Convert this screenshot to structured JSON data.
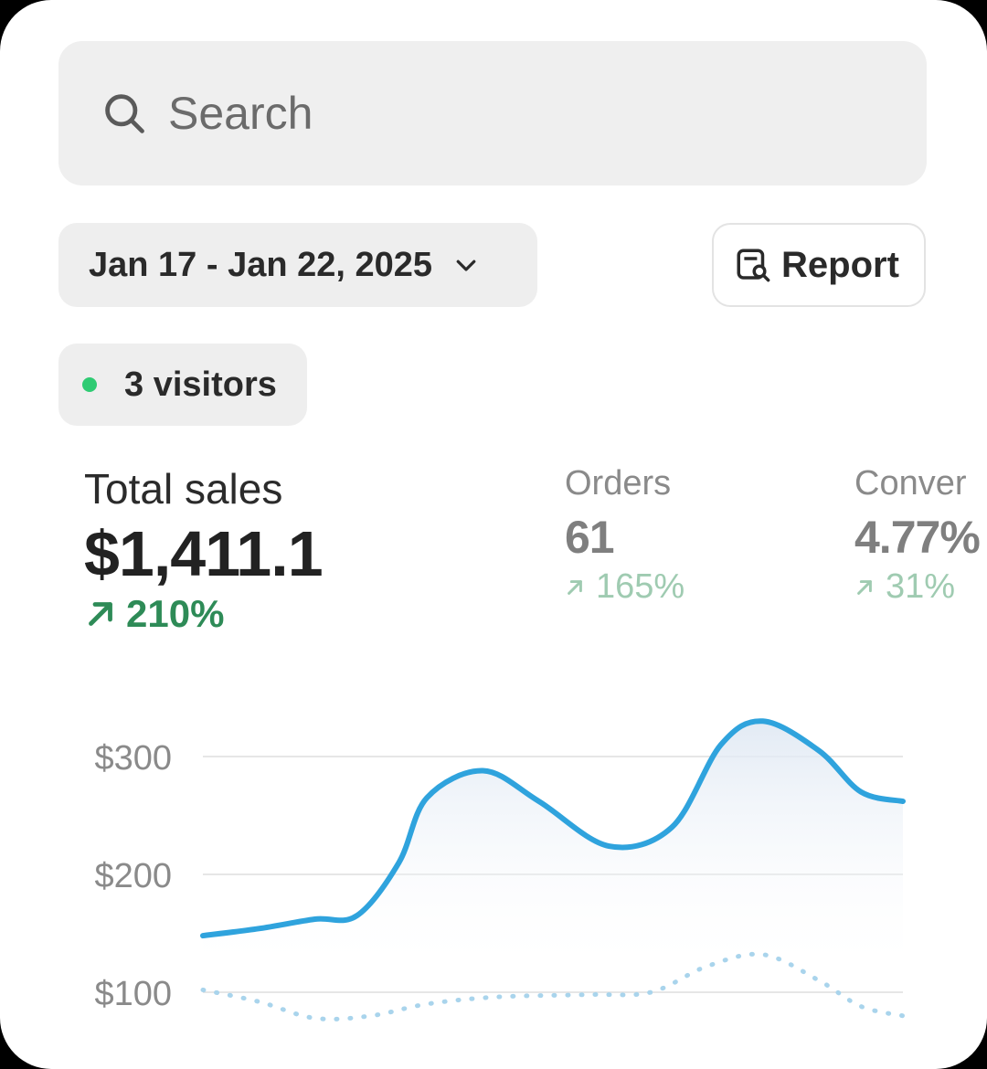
{
  "search": {
    "placeholder": "Search"
  },
  "date_range": {
    "label": "Jan 17 - Jan 22, 2025"
  },
  "report_button": {
    "label": "Report"
  },
  "visitors_badge": {
    "label": "3 visitors"
  },
  "colors": {
    "accent_line": "#2fa3dd",
    "positive": "#2e8b57",
    "live_dot": "#2fcb73"
  },
  "metrics": [
    {
      "label": "Total sales",
      "value": "$1,411.1",
      "change": "210%"
    },
    {
      "label": "Orders",
      "value": "61",
      "change": "165%"
    },
    {
      "label": "Conver",
      "value": "4.77%",
      "change": "31%"
    }
  ],
  "chart_data": {
    "type": "line",
    "yticks": [
      "$300",
      "$200",
      "$100"
    ],
    "ylim": [
      100,
      330
    ],
    "grid": true,
    "series": [
      {
        "style": "solid",
        "values": [
          [
            0,
            148
          ],
          [
            0.08,
            154
          ],
          [
            0.16,
            162
          ],
          [
            0.22,
            165
          ],
          [
            0.28,
            210
          ],
          [
            0.32,
            265
          ],
          [
            0.4,
            288
          ],
          [
            0.48,
            262
          ],
          [
            0.58,
            224
          ],
          [
            0.67,
            240
          ],
          [
            0.74,
            310
          ],
          [
            0.8,
            330
          ],
          [
            0.88,
            305
          ],
          [
            0.94,
            270
          ],
          [
            1,
            262
          ]
        ]
      },
      {
        "style": "dotted",
        "values": [
          [
            0,
            102
          ],
          [
            0.08,
            92
          ],
          [
            0.16,
            78
          ],
          [
            0.24,
            80
          ],
          [
            0.32,
            90
          ],
          [
            0.42,
            96
          ],
          [
            0.55,
            98
          ],
          [
            0.64,
            100
          ],
          [
            0.72,
            122
          ],
          [
            0.8,
            132
          ],
          [
            0.88,
            110
          ],
          [
            0.94,
            88
          ],
          [
            1,
            80
          ]
        ]
      }
    ]
  }
}
